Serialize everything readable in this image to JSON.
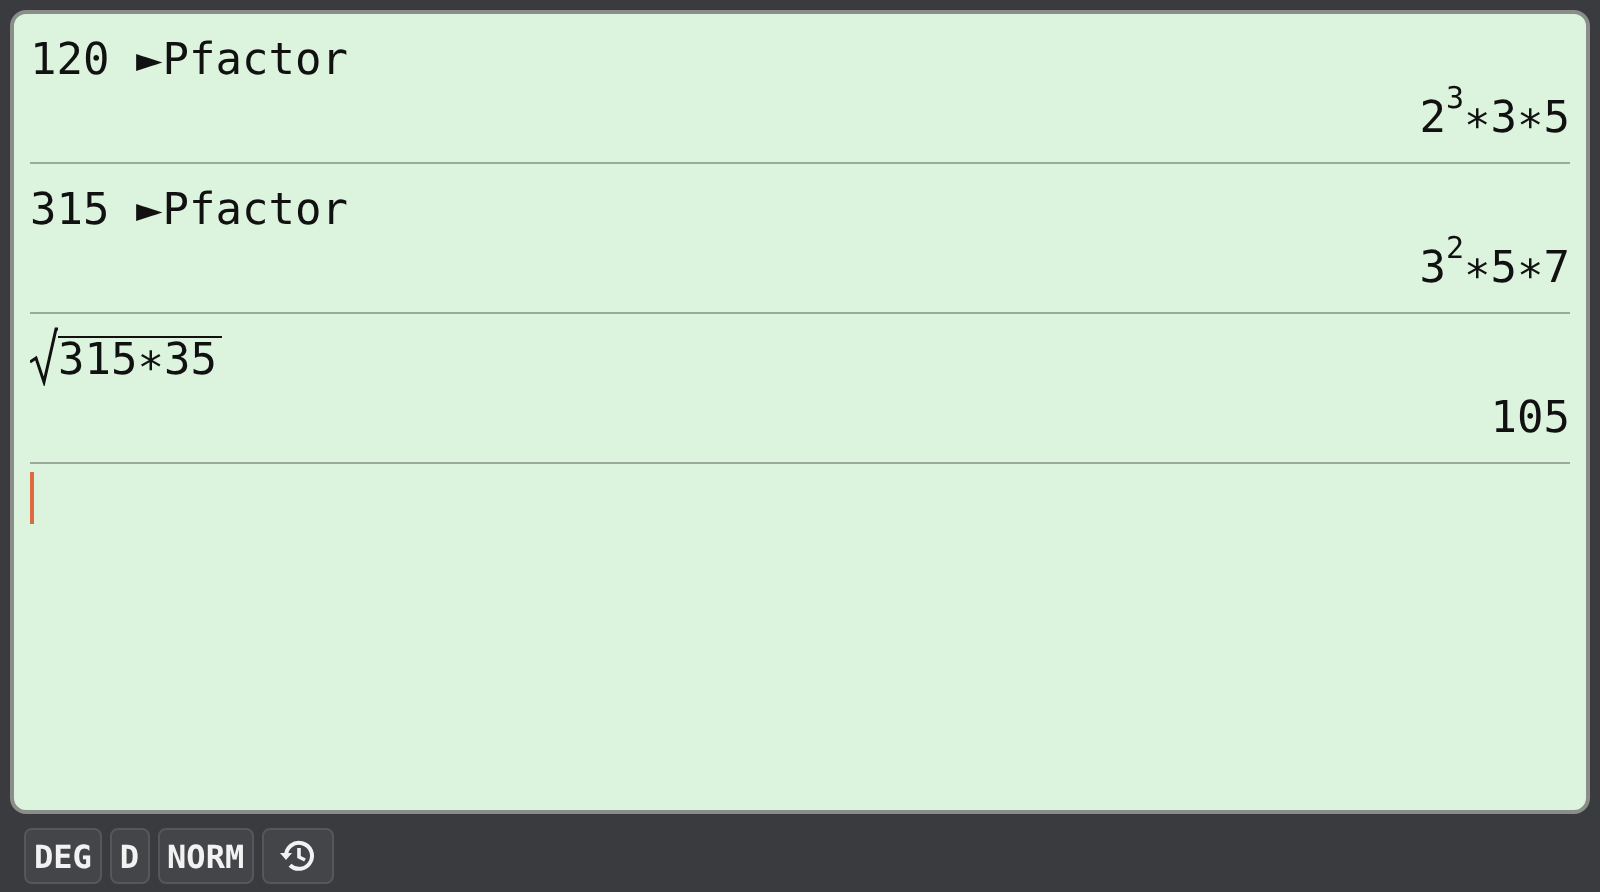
{
  "history": [
    {
      "input": {
        "kind": "plain",
        "text": "120 ►Pfactor"
      },
      "output": "2$^{3}$∗3∗5"
    },
    {
      "input": {
        "kind": "plain",
        "text": "315 ►Pfactor"
      },
      "output": "3$^{2}$∗5∗7"
    },
    {
      "input": {
        "kind": "sqrt",
        "text": "315∗35"
      },
      "output": "105"
    }
  ],
  "status_bar": {
    "buttons": [
      {
        "kind": "text",
        "label": "DEG"
      },
      {
        "kind": "text",
        "label": "D"
      },
      {
        "kind": "text",
        "label": "NORM"
      },
      {
        "kind": "history"
      }
    ]
  }
}
